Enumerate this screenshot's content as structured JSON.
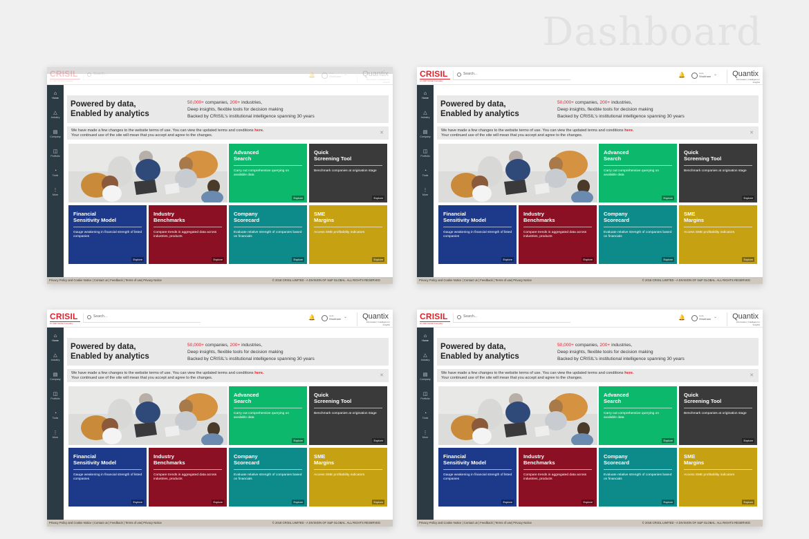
{
  "page_heading": "Dashboard",
  "brand": {
    "logo": "CRISIL",
    "logo_sub": "An S&P Global Company",
    "product": "Quantix",
    "product_sub": "Information | Intelligence | Insights"
  },
  "header": {
    "search_placeholder": "Search...",
    "hello": "Hello",
    "user_name": "Shubham"
  },
  "sidebar": [
    {
      "icon": "home-icon",
      "label": "Home"
    },
    {
      "icon": "industry-icon",
      "label": "Industry"
    },
    {
      "icon": "company-icon",
      "label": "Company"
    },
    {
      "icon": "portfolio-icon",
      "label": "Portfolio"
    },
    {
      "icon": "tools-icon",
      "label": "Tools"
    },
    {
      "icon": "more-icon",
      "label": "More"
    }
  ],
  "hero": {
    "line1": "Powered by data,",
    "line2": "Enabled by analytics",
    "stat1_value": "50,000+",
    "stat1_text": " companies, ",
    "stat2_value": "200+",
    "stat2_text": " industries,",
    "info2": "Deep insights, flexible tools for decision making",
    "info3": "Backed by CRISIL's institutional intelligence spanning 30 years"
  },
  "notice": {
    "text1": "We have made a few changes to the website terms of use. You can view the updated terms and conditions ",
    "link": "here.",
    "text2": "Your continued use of the site will mean that you accept and agree to the changes."
  },
  "tiles": [
    {
      "title1": "Advanced",
      "title2": "Search",
      "desc": "Carry out comprehensive querying on available data",
      "explore": "Explore",
      "color": "#0cb86b"
    },
    {
      "title1": "Quick",
      "title2": "Screening Tool",
      "desc": "Benchmark companies at origination stage",
      "explore": "Explore",
      "color": "#3a3a3a"
    },
    {
      "title1": "Financial",
      "title2": "Sensitivity Model",
      "desc": "Gauge weakening in financial strength of listed companies",
      "explore": "Explore",
      "color": "#1d3a8a"
    },
    {
      "title1": "Industry",
      "title2": "Benchmarks",
      "desc": "Compare trends in aggregated data across industries, products",
      "explore": "Explore",
      "color": "#8b1023"
    },
    {
      "title1": "Company",
      "title2": "Scorecard",
      "desc": "Evaluate relative strength of companies based on financials",
      "explore": "Explore",
      "color": "#0c8b8a"
    },
    {
      "title1": "SME",
      "title2": "Margins",
      "desc": "Access SME profitability indicators",
      "explore": "Explore",
      "color": "#c6a112"
    }
  ],
  "footer": {
    "links": "Privacy Policy and Cookie Notice | Contact us | Feedback | Terms of use| Privacy Notice",
    "copyright": "© 2018 CRISIL LIMITED - A DIVISION OF S&P GLOBAL. ALL RIGHTS RESERVED"
  }
}
